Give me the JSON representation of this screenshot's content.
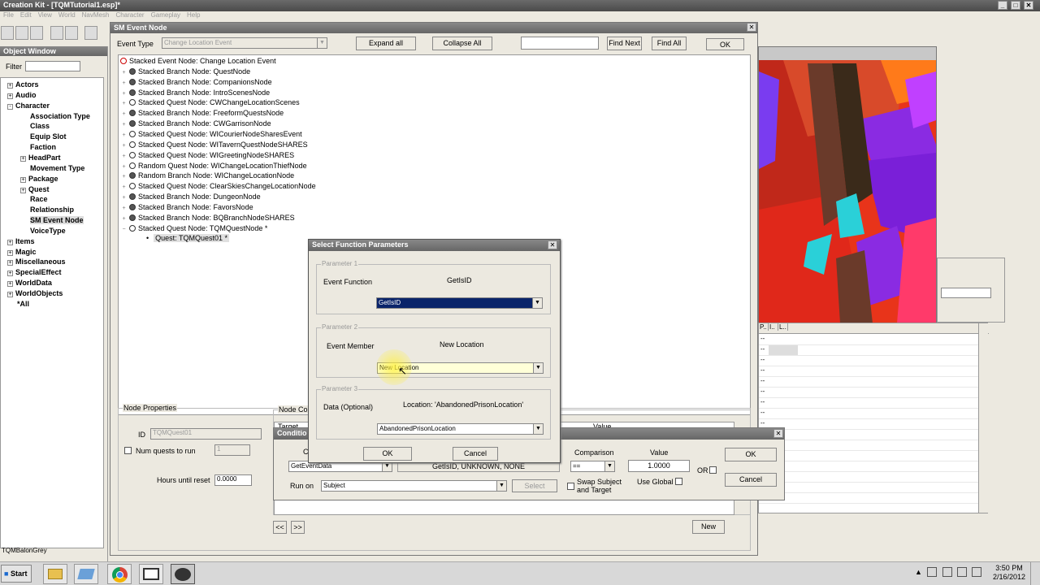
{
  "app": {
    "title": "Creation Kit - [TQMTutorial1.esp]*",
    "menu": [
      "File",
      "Edit",
      "View",
      "World",
      "NavMesh",
      "Character",
      "Gameplay",
      "Help"
    ]
  },
  "object_window": {
    "title": "Object Window",
    "filter_label": "Filter",
    "filter_value": "",
    "tree": [
      {
        "label": "Actors",
        "level": 0,
        "expander": "+"
      },
      {
        "label": "Audio",
        "level": 0,
        "expander": "+"
      },
      {
        "label": "Character",
        "level": 0,
        "expander": "-"
      },
      {
        "label": "Association Type",
        "level": 1,
        "expander": ""
      },
      {
        "label": "Class",
        "level": 1,
        "expander": ""
      },
      {
        "label": "Equip Slot",
        "level": 1,
        "expander": ""
      },
      {
        "label": "Faction",
        "level": 1,
        "expander": ""
      },
      {
        "label": "HeadPart",
        "level": 1,
        "expander": "+"
      },
      {
        "label": "Movement Type",
        "level": 1,
        "expander": ""
      },
      {
        "label": "Package",
        "level": 1,
        "expander": "+"
      },
      {
        "label": "Quest",
        "level": 1,
        "expander": "+"
      },
      {
        "label": "Race",
        "level": 1,
        "expander": ""
      },
      {
        "label": "Relationship",
        "level": 1,
        "expander": ""
      },
      {
        "label": "SM Event Node",
        "level": 1,
        "expander": "",
        "selected": true
      },
      {
        "label": "VoiceType",
        "level": 1,
        "expander": ""
      },
      {
        "label": "Items",
        "level": 0,
        "expander": "+"
      },
      {
        "label": "Magic",
        "level": 0,
        "expander": "+"
      },
      {
        "label": "Miscellaneous",
        "level": 0,
        "expander": "+"
      },
      {
        "label": "SpecialEffect",
        "level": 0,
        "expander": "+"
      },
      {
        "label": "WorldData",
        "level": 0,
        "expander": "+"
      },
      {
        "label": "WorldObjects",
        "level": 0,
        "expander": "+"
      },
      {
        "label": "*All",
        "level": 0,
        "expander": ""
      }
    ],
    "status": "TQMBalonGrey"
  },
  "sm_event_node": {
    "title": "SM Event Node",
    "event_type_label": "Event Type",
    "event_type_value": "Change Location Event",
    "expand_all": "Expand all",
    "collapse_all": "Collapse All",
    "find_next": "Find Next",
    "find_all": "Find All",
    "ok": "OK",
    "nodes": [
      {
        "text": "Stacked Event Node: Change Location Event",
        "icon": "root",
        "indent": 0
      },
      {
        "text": "Stacked Branch Node: QuestNode",
        "icon": "filled",
        "indent": 1
      },
      {
        "text": "Stacked Branch Node: CompanionsNode",
        "icon": "filled",
        "indent": 1
      },
      {
        "text": "Stacked Branch Node: IntroScenesNode",
        "icon": "filled",
        "indent": 1
      },
      {
        "text": "Stacked Quest Node: CWChangeLocationScenes",
        "icon": "empty",
        "indent": 1
      },
      {
        "text": "Stacked Branch Node: FreeformQuestsNode",
        "icon": "filled",
        "indent": 1
      },
      {
        "text": "Stacked Branch Node: CWGarrisonNode",
        "icon": "filled",
        "indent": 1
      },
      {
        "text": "Stacked Quest Node: WICourierNodeSharesEvent",
        "icon": "empty",
        "indent": 1
      },
      {
        "text": "Stacked Quest Node: WITavernQuestNodeSHARES",
        "icon": "empty",
        "indent": 1
      },
      {
        "text": "Stacked Quest Node: WIGreetingNodeSHARES",
        "icon": "empty",
        "indent": 1
      },
      {
        "text": "Random Quest Node: WIChangeLocationThiefNode",
        "icon": "empty",
        "indent": 1
      },
      {
        "text": "Random Branch Node: WIChangeLocationNode",
        "icon": "filled",
        "indent": 1
      },
      {
        "text": "Stacked Quest Node: ClearSkiesChangeLocationNode",
        "icon": "empty",
        "indent": 1
      },
      {
        "text": "Stacked Branch Node: DungeonNode",
        "icon": "filled",
        "indent": 1
      },
      {
        "text": "Stacked Branch Node: FavorsNode",
        "icon": "filled",
        "indent": 1
      },
      {
        "text": "Stacked Branch Node: BQBranchNodeSHARES",
        "icon": "filled",
        "indent": 1
      },
      {
        "text": "Stacked Quest Node: TQMQuestNode *",
        "icon": "empty",
        "indent": 1
      },
      {
        "text": "Quest: TQMQuest01 *",
        "icon": "bullet",
        "indent": 2,
        "selected": true
      }
    ],
    "node_properties": {
      "title": "Node Properties",
      "id_label": "ID",
      "id_value": "TQMQuest01",
      "num_quests_label": "Num quests to run",
      "num_quests_value": "1",
      "hours_label": "Hours until reset",
      "hours_value": "0.0000",
      "node_cond_label": "Node Cor",
      "target_header": "Target",
      "value_header": "Value",
      "prev": "<<",
      "next": ">>",
      "new": "New"
    }
  },
  "select_function": {
    "title": "Select Function Parameters",
    "param1": {
      "group": "Parameter 1",
      "label": "Event Function",
      "display": "GetIsID",
      "value": "GetIsID"
    },
    "param2": {
      "group": "Parameter 2",
      "label": "Event Member",
      "display": "New Location",
      "value": "New Location"
    },
    "param3": {
      "group": "Parameter 3",
      "label": "Data (Optional)",
      "display": "Location: 'AbandonedPrisonLocation'",
      "value": "AbandonedPrisonLocation"
    },
    "ok": "OK",
    "cancel": "Cancel"
  },
  "condition": {
    "title": "Conditio",
    "c_label": "C",
    "function_value": "GetEventData",
    "params_text": "GetIsID, UNKNOWN, NONE",
    "comparison_label": "Comparison",
    "comparison_value": "==",
    "value_label": "Value",
    "value_value": "1.0000",
    "or_label": "OR",
    "run_on_label": "Run on",
    "run_on_value": "Subject",
    "select": "Select",
    "swap_label": "Swap Subject and Target",
    "use_global_label": "Use Global",
    "ok": "OK",
    "cancel": "Cancel"
  },
  "right_pane": {
    "headers": [
      "P..",
      "I..",
      "L.."
    ],
    "rows": [
      "--",
      "--",
      "--",
      "--",
      "--",
      "--",
      "--",
      "--",
      "--",
      "--",
      "--",
      "--",
      "--",
      "--",
      "--",
      "--"
    ]
  },
  "taskbar": {
    "start": "Start",
    "time": "3:50 PM",
    "date": "2/16/2012"
  },
  "colors": {
    "title_bar": "#5a5a5a",
    "selection": "#0a246a",
    "dialog_bg": "#ece9e0"
  }
}
